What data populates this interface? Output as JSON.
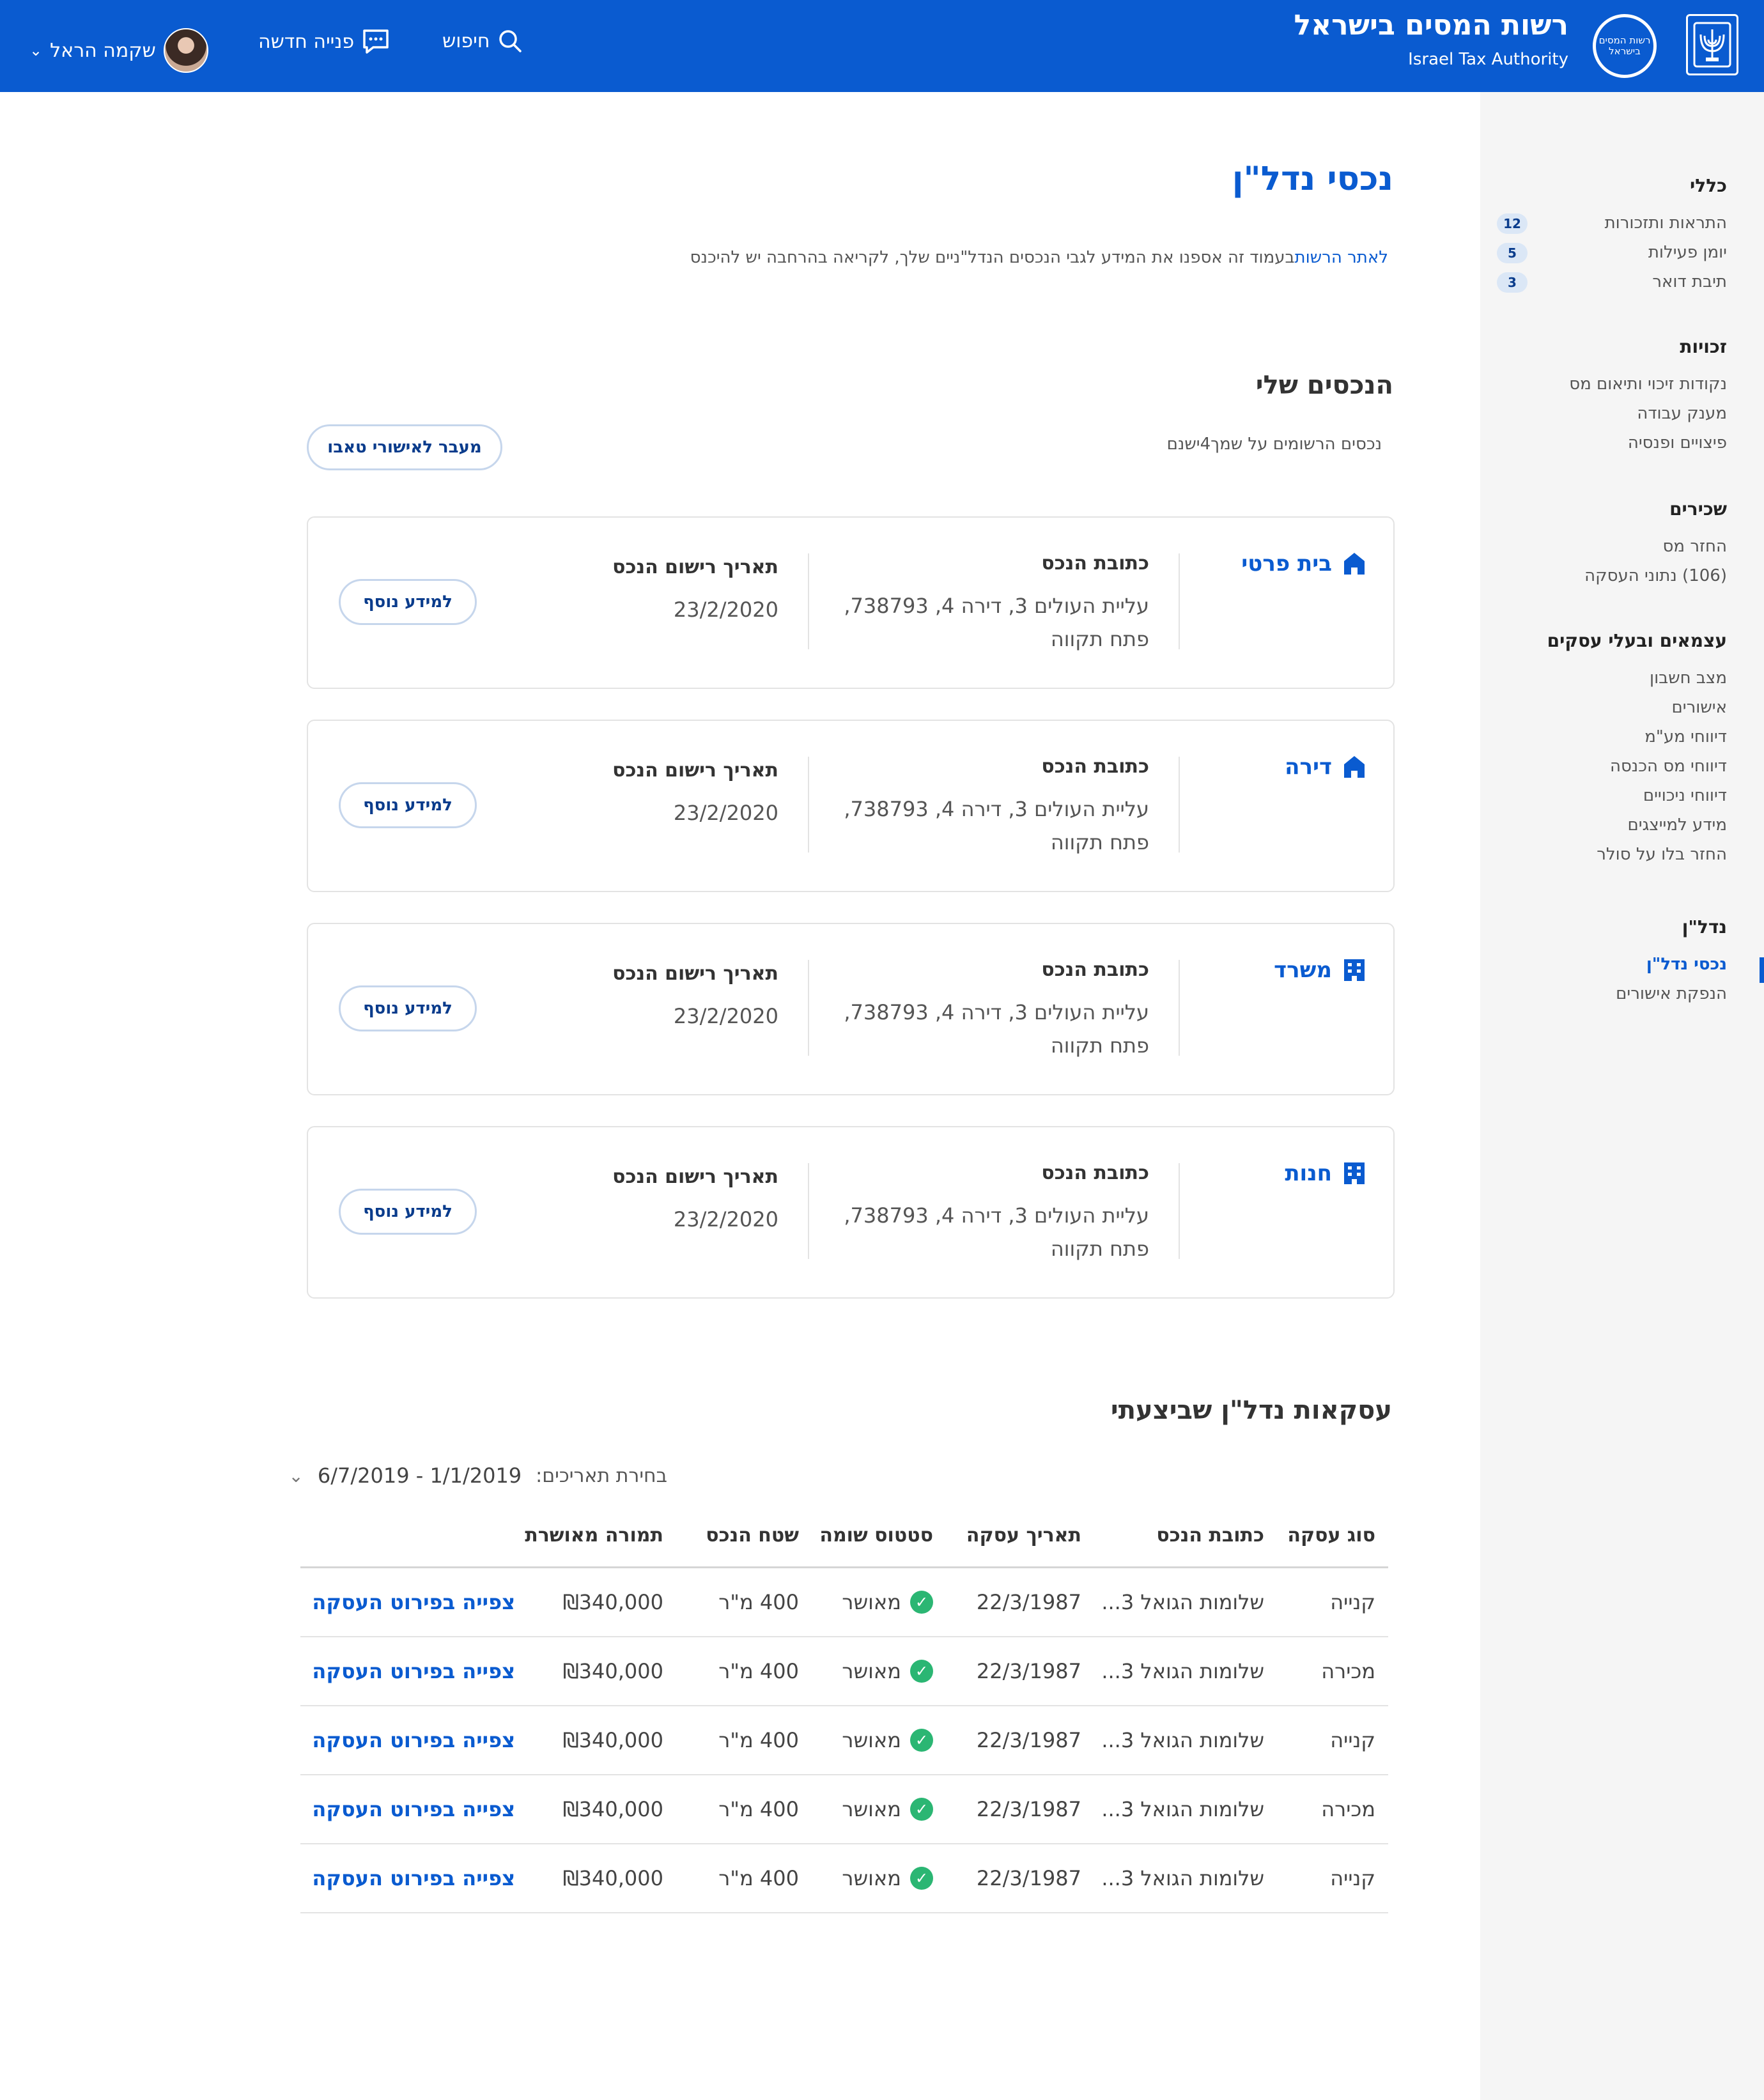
{
  "header": {
    "org_name_he": "רשות המסים בישראל",
    "org_name_en": "Israel Tax Authority",
    "seal_text": "רשות המסים בישראל",
    "search_label": "חיפוש",
    "new_request_label": "פנייה חדשה",
    "user_name": "שקמה הראל",
    "brand_color": "#0a5bd0"
  },
  "sidebar": {
    "sections": [
      {
        "title": "כללי",
        "items": [
          {
            "label": "התראות ותזכורות",
            "badge": "12"
          },
          {
            "label": "יומן פעילות",
            "badge": "5"
          },
          {
            "label": "תיבת דואר",
            "badge": "3"
          }
        ]
      },
      {
        "title": "זכויות",
        "items": [
          {
            "label": "נקודות זיכוי ותיאום מס"
          },
          {
            "label": "מענק עבודה"
          },
          {
            "label": "פיצויים ופנסיה"
          }
        ]
      },
      {
        "title": "שכירים",
        "items": [
          {
            "label": "החזר מס"
          },
          {
            "label": "(106) נתוני העסקה"
          }
        ]
      },
      {
        "title": "עצמאים ובעלי עסקים",
        "items": [
          {
            "label": "מצב חשבון"
          },
          {
            "label": "אישורים"
          },
          {
            "label": "דיווחי מע\"מ"
          },
          {
            "label": "דיווחי מס הכנסה"
          },
          {
            "label": "דיווחי ניכויים"
          },
          {
            "label": "מידע למייצגים"
          },
          {
            "label": "החזר בלו על סולר"
          }
        ]
      },
      {
        "title": "נדל\"ן",
        "items": [
          {
            "label": "נכסי נדל\"ן",
            "active": true
          },
          {
            "label": "הנפקת אישורים"
          }
        ]
      }
    ]
  },
  "main": {
    "title": "נכסי נדל\"ן",
    "intro_link": "לאתר הרשות",
    "intro_text": "בעמוד זה אספנו את המידע לגבי הנכסים הנדל\"ניים שלך, לקריאה בהרחבה יש להיכנס",
    "assets_title": "הנכסים שלי",
    "assets_count": "נכסים הרשומים על שמך4ישנם",
    "tabu_button": "מעבר לאישורי טאבו",
    "assets": [
      {
        "type": "בית פרטי",
        "icon": "house-icon",
        "address_label": "כתובת הנכס",
        "address_line1": "עליית העולים 3, דירה 4, 738793,",
        "address_line2": "פתח תקווה",
        "date_label": "תאריך רישום הנכס",
        "date": "23/2/2020",
        "more": "למידע נוסף"
      },
      {
        "type": "דירה",
        "icon": "house-icon",
        "address_label": "כתובת הנכס",
        "address_line1": "עליית העולים 3, דירה 4, 738793,",
        "address_line2": "פתח תקווה",
        "date_label": "תאריך רישום הנכס",
        "date": "23/2/2020",
        "more": "למידע נוסף"
      },
      {
        "type": "משרד",
        "icon": "building-icon",
        "address_label": "כתובת הנכס",
        "address_line1": "עליית העולים 3, דירה 4, 738793,",
        "address_line2": "פתח תקווה",
        "date_label": "תאריך רישום הנכס",
        "date": "23/2/2020",
        "more": "למידע נוסף"
      },
      {
        "type": "חנות",
        "icon": "building-icon",
        "address_label": "כתובת הנכס",
        "address_line1": "עליית העולים 3, דירה 4, 738793,",
        "address_line2": "פתח תקווה",
        "date_label": "תאריך רישום הנכס",
        "date": "23/2/2020",
        "more": "למידע נוסף"
      }
    ],
    "deals_title": "עסקאות נדל\"ן שביצעתי",
    "filter_label": "בחירת תאריכים:",
    "filter_range": "1/1/2019 - 6/7/2019",
    "table": {
      "headers": [
        "סוג עסקה",
        "כתובת הנכס",
        "תאריך עסקה",
        "סטטוס שומה",
        "שטח הנכס",
        "תמורה מאושרת"
      ],
      "rows": [
        {
          "type": "קנייה",
          "address": "שלומות הגואל 3...",
          "date": "22/3/1987",
          "status": "מאושר",
          "area": "400 מ\"ר",
          "price": "₪340,000",
          "link": "צפייה בפירוט העסקה"
        },
        {
          "type": "מכירה",
          "address": "שלומות הגואל 3...",
          "date": "22/3/1987",
          "status": "מאושר",
          "area": "400 מ\"ר",
          "price": "₪340,000",
          "link": "צפייה בפירוט העסקה"
        },
        {
          "type": "קנייה",
          "address": "שלומות הגואל 3...",
          "date": "22/3/1987",
          "status": "מאושר",
          "area": "400 מ\"ר",
          "price": "₪340,000",
          "link": "צפייה בפירוט העסקה"
        },
        {
          "type": "מכירה",
          "address": "שלומות הגואל 3...",
          "date": "22/3/1987",
          "status": "מאושר",
          "area": "400 מ\"ר",
          "price": "₪340,000",
          "link": "צפייה בפירוט העסקה"
        },
        {
          "type": "קנייה",
          "address": "שלומות הגואל 3...",
          "date": "22/3/1987",
          "status": "מאושר",
          "area": "400 מ\"ר",
          "price": "₪340,000",
          "link": "צפייה בפירוט העסקה"
        }
      ]
    }
  }
}
